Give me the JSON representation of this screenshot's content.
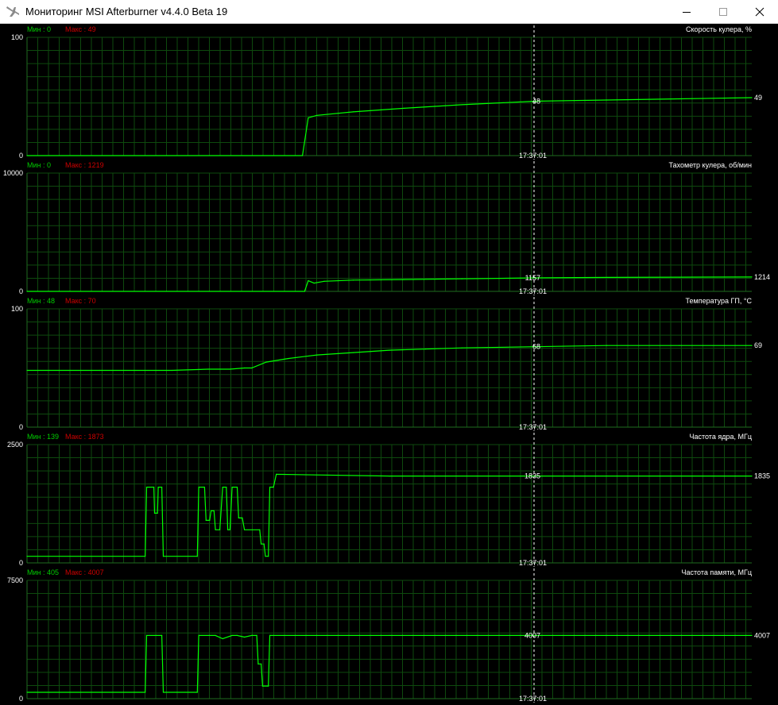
{
  "window": {
    "title": "Мониторинг MSI Afterburner v4.4.0 Beta 19",
    "icons": {
      "app": "afterburner-plane-icon",
      "minimize": "minimize-icon",
      "maximize": "maximize-icon",
      "close": "close-icon"
    }
  },
  "colors": {
    "background": "#000000",
    "grid": "#0e4a0e",
    "axis": "#1f6b1f",
    "line": "#00ff00",
    "min_label": "#00cc00",
    "max_label": "#cc0000",
    "text": "#ffffff",
    "cursor": "#ffffff"
  },
  "cursor_time": "17:37:01",
  "chart_data": [
    {
      "type": "line",
      "title": "Скорость кулера, %",
      "min_label": "Мин : 0",
      "max_label": "Макс : 49",
      "ylim": [
        0,
        100
      ],
      "y_top_label": "100",
      "y_bottom_label": "0",
      "cursor_value": "48",
      "current_value": "49",
      "x": [
        0.0,
        0.38,
        0.388,
        0.4,
        0.45,
        0.52,
        0.6,
        0.7,
        0.8,
        0.9,
        1.0
      ],
      "values": [
        0,
        0,
        32,
        34,
        37,
        40,
        43,
        46,
        47,
        48,
        49
      ]
    },
    {
      "type": "line",
      "title": "Тахометр кулера, об/мин",
      "min_label": "Мин : 0",
      "max_label": "Макс : 1219",
      "ylim": [
        0,
        10000
      ],
      "y_top_label": "10000",
      "y_bottom_label": "0",
      "cursor_value": "1157",
      "current_value": "1214",
      "x": [
        0.0,
        0.383,
        0.388,
        0.396,
        0.41,
        0.45,
        0.52,
        0.6,
        0.7,
        0.8,
        0.9,
        1.0
      ],
      "values": [
        0,
        0,
        900,
        700,
        850,
        950,
        1000,
        1060,
        1140,
        1180,
        1200,
        1214
      ]
    },
    {
      "type": "line",
      "title": "Температура ГП, °C",
      "min_label": "Мин : 48",
      "max_label": "Макс : 70",
      "ylim": [
        0,
        100
      ],
      "y_top_label": "100",
      "y_bottom_label": "0",
      "cursor_value": "68",
      "current_value": "69",
      "x": [
        0.0,
        0.1,
        0.2,
        0.25,
        0.28,
        0.3,
        0.31,
        0.33,
        0.36,
        0.4,
        0.45,
        0.5,
        0.55,
        0.6,
        0.7,
        0.8,
        0.9,
        1.0
      ],
      "values": [
        48,
        48,
        48,
        49,
        49,
        50,
        50,
        55,
        58,
        61,
        63,
        65,
        66,
        67,
        68,
        69,
        69,
        69
      ]
    },
    {
      "type": "line",
      "title": "Частота ядра, МГц",
      "min_label": "Мин : 139",
      "max_label": "Макс : 1873",
      "ylim": [
        0,
        2500
      ],
      "y_top_label": "2500",
      "y_bottom_label": "0",
      "cursor_value": "1835",
      "current_value": "1835",
      "x": [
        0.0,
        0.163,
        0.165,
        0.175,
        0.176,
        0.18,
        0.181,
        0.186,
        0.188,
        0.235,
        0.237,
        0.245,
        0.247,
        0.252,
        0.254,
        0.258,
        0.26,
        0.266,
        0.27,
        0.275,
        0.277,
        0.28,
        0.283,
        0.29,
        0.292,
        0.297,
        0.3,
        0.321,
        0.323,
        0.327,
        0.329,
        0.333,
        0.335,
        0.34,
        0.344,
        0.5,
        1.0
      ],
      "values": [
        139,
        139,
        1600,
        1600,
        1050,
        1050,
        1600,
        1600,
        139,
        139,
        1600,
        1600,
        900,
        900,
        1100,
        1100,
        700,
        700,
        1600,
        1600,
        700,
        700,
        1600,
        1600,
        950,
        950,
        700,
        700,
        400,
        400,
        139,
        139,
        1600,
        1600,
        1873,
        1835,
        1835
      ]
    },
    {
      "type": "line",
      "title": "Частота памяти, МГц",
      "min_label": "Мин : 405",
      "max_label": "Макс : 4007",
      "ylim": [
        0,
        7500
      ],
      "y_top_label": "7500",
      "y_bottom_label": "0",
      "cursor_value": "4007",
      "current_value": "4007",
      "x": [
        0.0,
        0.163,
        0.165,
        0.186,
        0.188,
        0.235,
        0.237,
        0.26,
        0.27,
        0.283,
        0.29,
        0.3,
        0.31,
        0.317,
        0.319,
        0.323,
        0.325,
        0.333,
        0.335,
        0.5,
        1.0
      ],
      "values": [
        405,
        405,
        4007,
        4007,
        405,
        405,
        4007,
        4007,
        3800,
        4007,
        4007,
        3900,
        4007,
        4007,
        2200,
        2200,
        800,
        800,
        4007,
        4007,
        4007
      ]
    }
  ]
}
